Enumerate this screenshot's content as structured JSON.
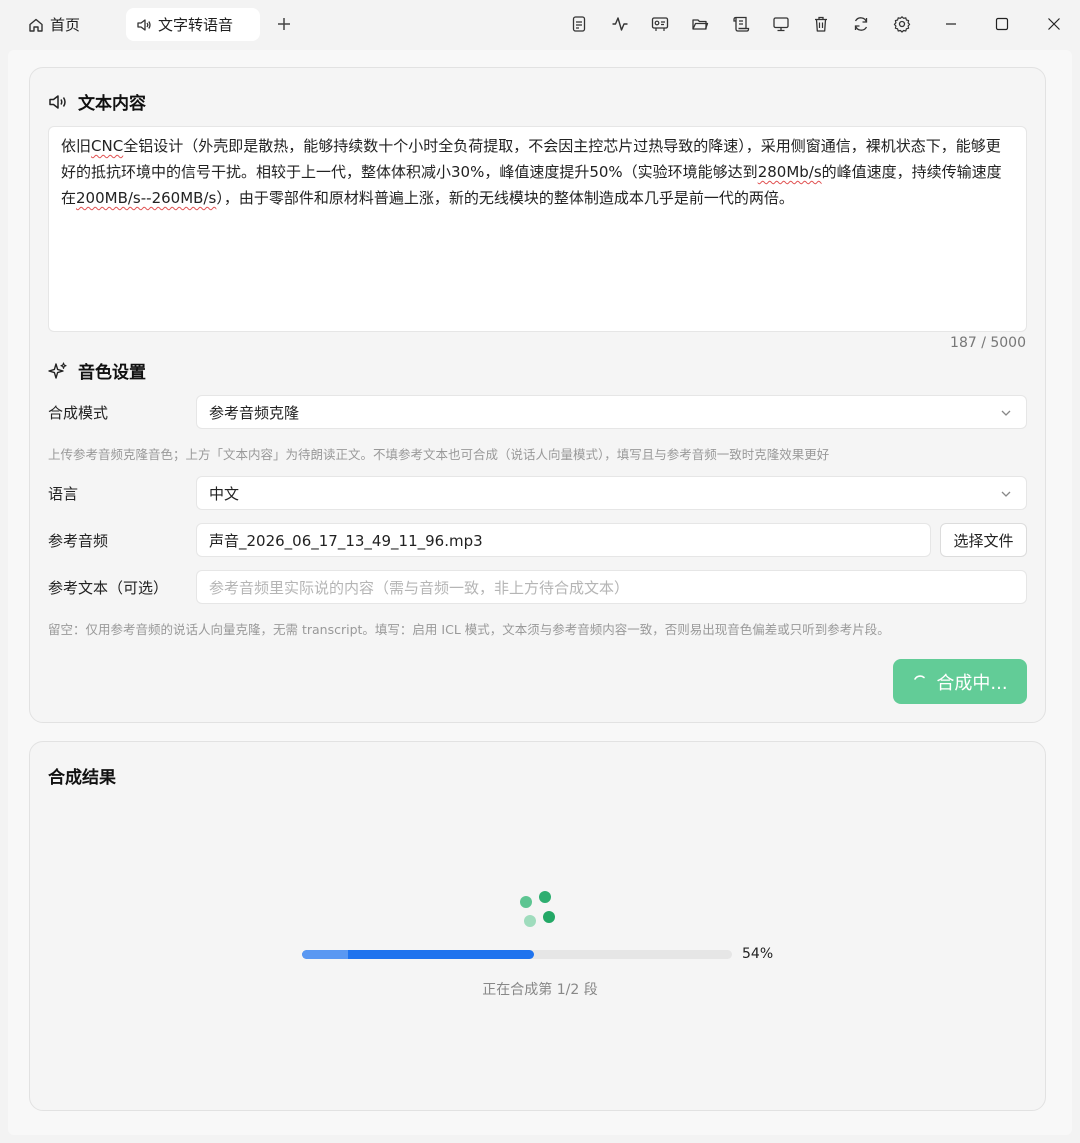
{
  "tabs": {
    "home_label": "首页",
    "active_label": "文字转语音"
  },
  "text_section": {
    "title": "文本内容",
    "content_parts": [
      "依旧",
      "CNC",
      "全铝设计（外壳即是散热，能够持续数十个小时全负荷提取，不会因主控芯片过热导致的降速），采用侧窗通信，裸机状态下，能够更好的抵抗环境中的信号干扰。相较于上一代，整体体积减小30%，峰值速度提升50%（实验环境能够达到",
      "280Mb/s",
      "的峰值速度，持续传输速度在",
      "200MB/s--260MB/s",
      "），由于零部件和原材料普遍上涨，新的无线模块的整体制造成本几乎是前一代的两倍。"
    ],
    "counter": "187 / 5000"
  },
  "voice_section": {
    "title": "音色设置",
    "mode_label": "合成模式",
    "mode_value": "参考音频克隆",
    "mode_hint": "上传参考音频克隆音色；上方「文本内容」为待朗读正文。不填参考文本也可合成（说话人向量模式），填写且与参考音频一致时克隆效果更好",
    "language_label": "语言",
    "language_value": "中文",
    "ref_audio_label": "参考音频",
    "ref_audio_value": "声音_2026_06_17_13_49_11_96.mp3",
    "choose_file": "选择文件",
    "ref_text_label": "参考文本（可选）",
    "ref_text_placeholder": "参考音频里实际说的内容（需与音频一致，非上方待合成文本）",
    "ref_text_hint": "留空：仅用参考音频的说话人向量克隆，无需 transcript。填写：启用 ICL 模式，文本须与参考音频内容一致，否则易出现音色偏差或只听到参考片段。",
    "synth_button": "合成中..."
  },
  "result_section": {
    "title": "合成结果",
    "progress": 0.54,
    "progress_text": "54%",
    "status_text": "正在合成第 1/2 段"
  },
  "colors": {
    "accent_green": "#62cc97",
    "progress_blue": "#1f73ee"
  }
}
